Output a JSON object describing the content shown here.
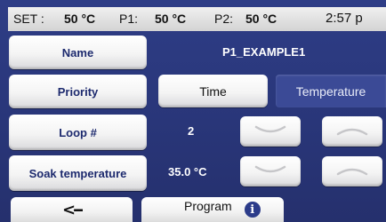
{
  "statusbar": {
    "set_label": "SET :",
    "set_value": "50 °C",
    "p1_label": "P1:",
    "p1_value": "50 °C",
    "p2_label": "P2:",
    "p2_value": "50 °C",
    "time": "2:57 p"
  },
  "rows": {
    "name": {
      "label": "Name",
      "value": "P1_EXAMPLE1"
    },
    "priority": {
      "label": "Priority",
      "options": [
        "Time",
        "Temperature"
      ],
      "selected": "Temperature"
    },
    "loop": {
      "label": "Loop #",
      "value": "2"
    },
    "soak": {
      "label": "Soak temperature",
      "value": "35.0 °C"
    }
  },
  "bottom": {
    "back_symbol": "<--",
    "program_label": "Program",
    "info_symbol": "i"
  },
  "colors": {
    "background": "#2b387c",
    "button_text": "#1d2a6e",
    "selected_segment": "#3b4a96"
  },
  "icons": {
    "down": "chevron-down-icon",
    "up": "chevron-up-icon",
    "back": "back-arrow-icon",
    "info": "info-icon"
  }
}
